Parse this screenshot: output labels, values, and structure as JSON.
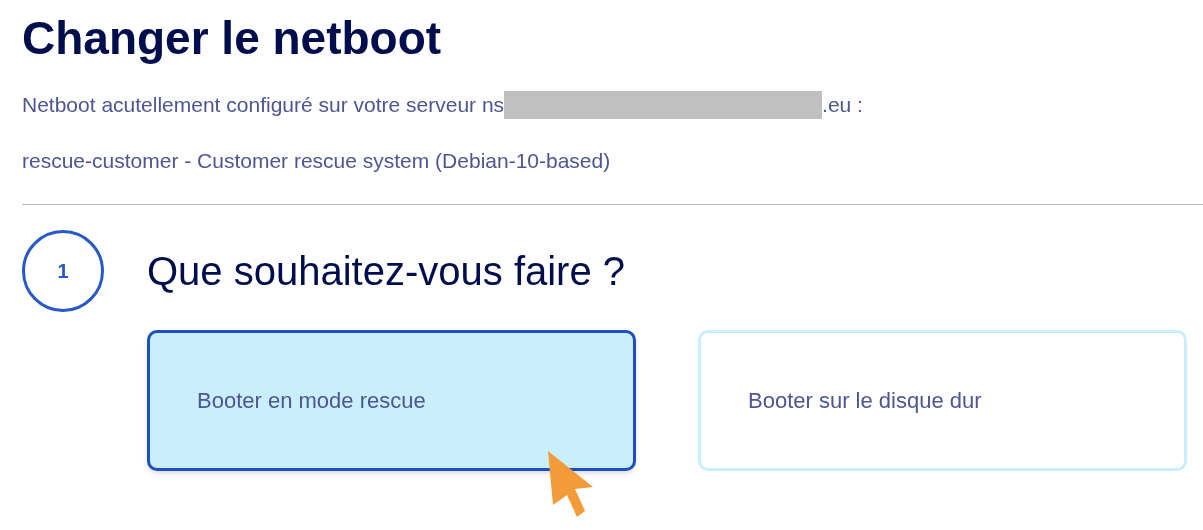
{
  "title": "Changer le netboot",
  "server_line": {
    "before": "Netboot acutellement configuré sur votre serveur ns",
    "after": ".eu :"
  },
  "current_netboot": "rescue-customer - Customer rescue system (Debian-10-based)",
  "step": {
    "number": "1",
    "title": "Que souhaitez-vous faire ?"
  },
  "options": [
    {
      "label": "Booter en mode rescue",
      "selected": true
    },
    {
      "label": "Booter sur le disque dur",
      "selected": false
    }
  ]
}
